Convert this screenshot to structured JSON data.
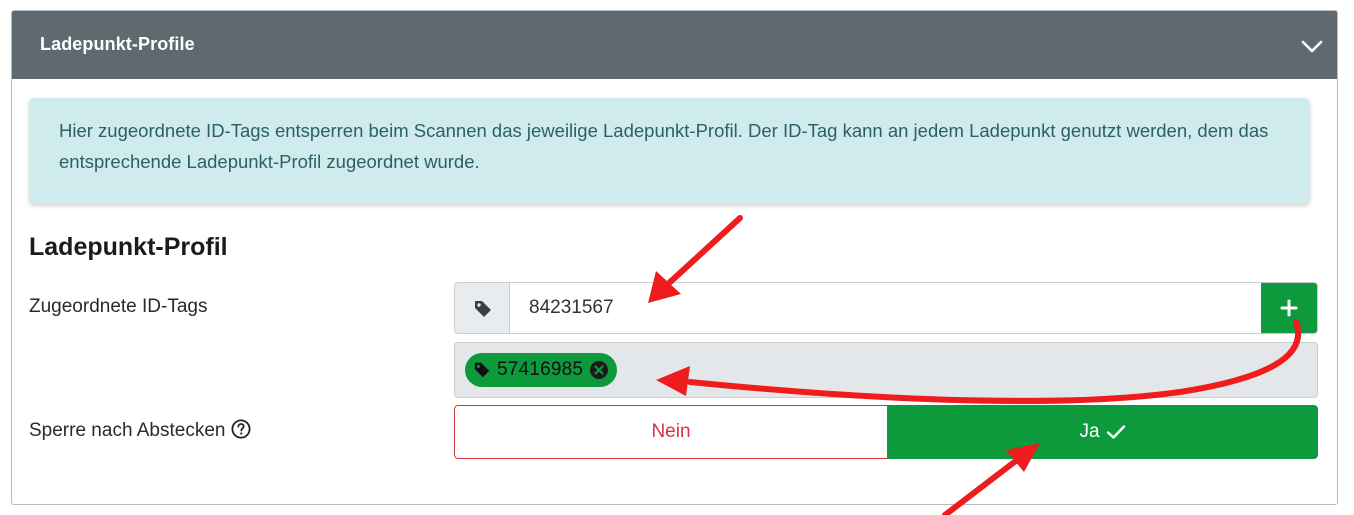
{
  "card": {
    "title": "Ladepunkt-Profile",
    "toggle_icon": "chevron-down-icon"
  },
  "info": {
    "text": "Hier zugeordnete ID-Tags entsperren beim Scannen das jeweilige Ladepunkt-Profil. Der ID-Tag kann an jedem Ladepunkt genutzt werden, dem das entsprechende Ladepunkt-Profil zugeordnet wurde."
  },
  "section": {
    "heading": "Ladepunkt-Profil"
  },
  "id_tags": {
    "label": "Zugeordnete ID-Tags",
    "prefix_icon": "tag-icon",
    "input_value": "84231567",
    "add_icon": "plus-icon",
    "assigned": [
      {
        "value": "57416985",
        "icon": "tag-icon",
        "remove_icon": "close-circle-icon"
      }
    ]
  },
  "lock_after_unplug": {
    "label": "Sperre nach Abstecken",
    "help_icon": "question-circle-icon",
    "options": {
      "no": "Nein",
      "yes": "Ja"
    },
    "selected": "yes",
    "selected_icon": "check-icon"
  },
  "colors": {
    "header_bg": "#5e6a70",
    "info_bg": "#d0ebee",
    "info_text": "#2c5f66",
    "primary_green": "#0d9a3d",
    "danger_red": "#d6343f",
    "annotation_arrow": "#ee1c1c"
  }
}
